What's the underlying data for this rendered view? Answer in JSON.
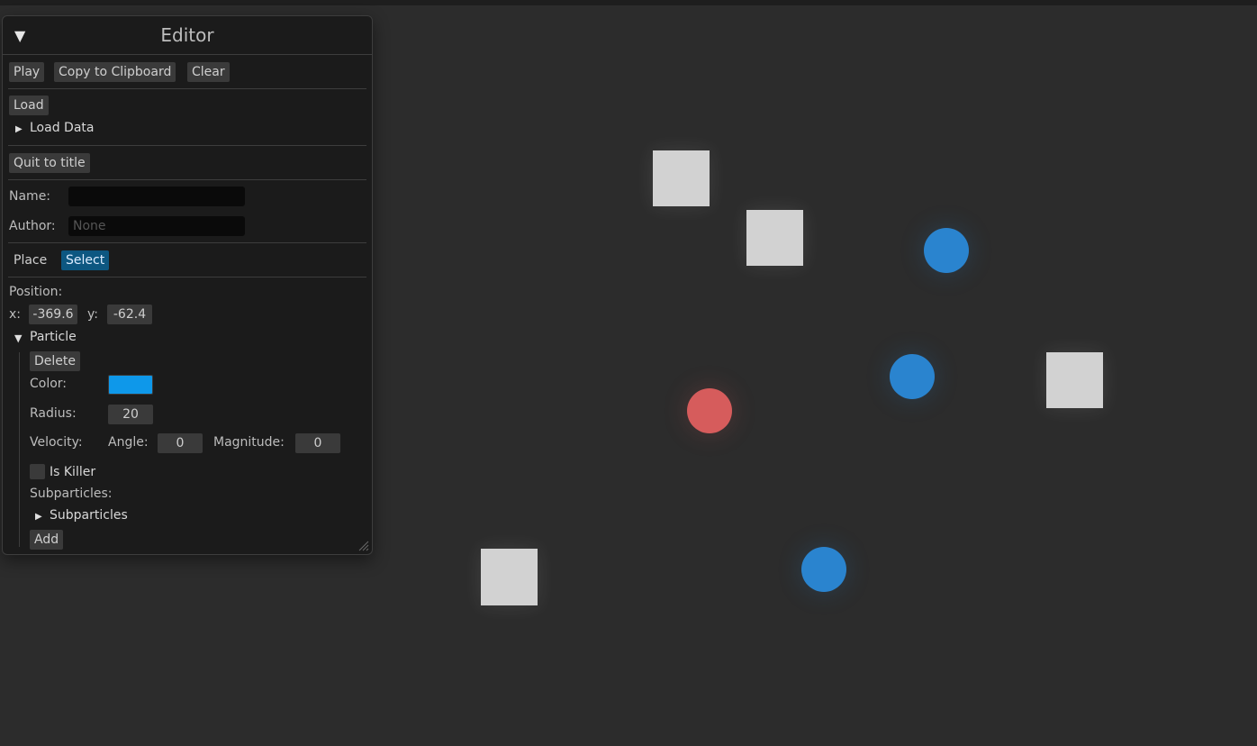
{
  "editor": {
    "title": "Editor",
    "toolbar": {
      "play": "Play",
      "copy": "Copy to Clipboard",
      "clear": "Clear"
    },
    "load": {
      "button": "Load",
      "section": "Load Data"
    },
    "quit": "Quit to title",
    "name": {
      "label": "Name:",
      "value": "",
      "placeholder": ""
    },
    "author": {
      "label": "Author:",
      "value": "",
      "placeholder": "None"
    },
    "mode": {
      "place": "Place",
      "select": "Select",
      "active": "Select"
    },
    "position": {
      "label": "Position:",
      "x_label": "x:",
      "x": "-369.6",
      "y_label": "y:",
      "y": "-62.4"
    },
    "particle": {
      "header": "Particle",
      "delete": "Delete",
      "color_label": "Color:",
      "color": "#0e98ea",
      "radius_label": "Radius:",
      "radius": "20",
      "velocity_label": "Velocity:",
      "angle_label": "Angle:",
      "angle": "0",
      "magnitude_label": "Magnitude:",
      "magnitude": "0",
      "is_killer_label": "Is Killer",
      "is_killer": false,
      "subparticles_label": "Subparticles:",
      "subparticles_section": "Subparticles",
      "add": "Add"
    }
  },
  "scene": {
    "background": "#2c2c2c",
    "squares": 4,
    "blue_particles": 3,
    "red_particles": 1,
    "blue_color": "#2a84cf",
    "red_color": "#d65c5c",
    "square_color": "#d2d2d2"
  },
  "icons": {
    "collapse": "triangle-down-icon",
    "section_collapsed": "triangle-right-icon",
    "section_expanded": "triangle-down-icon",
    "resize": "resize-grip-icon"
  }
}
